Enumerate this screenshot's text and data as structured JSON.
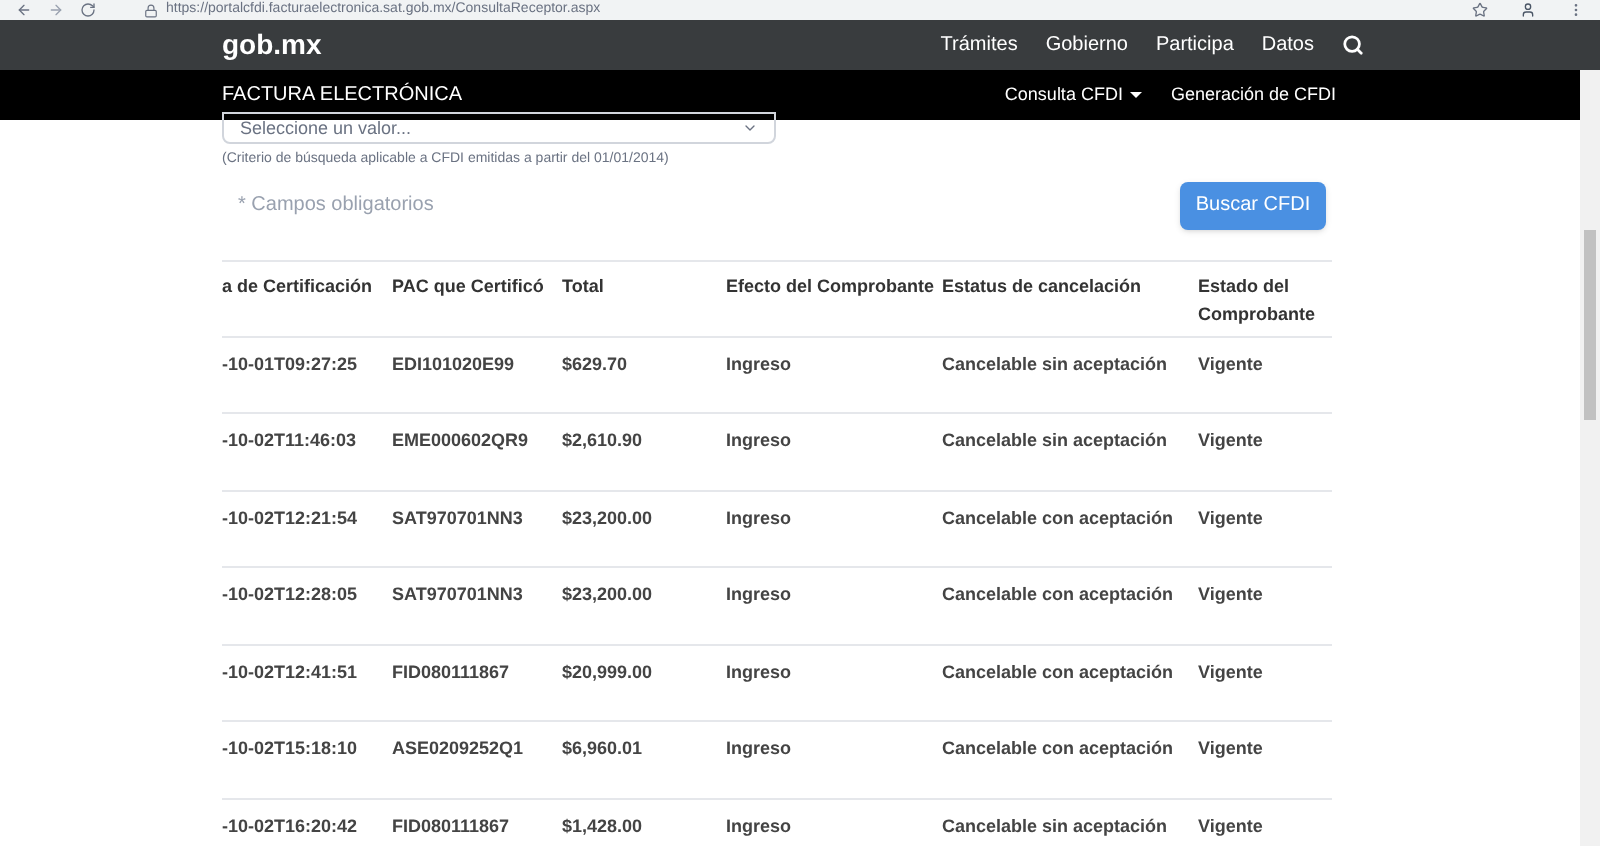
{
  "browser": {
    "url": "https://portalcfdi.facturaelectronica.sat.gob.mx/ConsultaReceptor.aspx"
  },
  "top_nav": {
    "logo": "gob.mx",
    "links": [
      "Trámites",
      "Gobierno",
      "Participa",
      "Datos"
    ]
  },
  "sub_nav": {
    "title": "FACTURA ELECTRÓNICA",
    "links": [
      {
        "label": "Consulta CFDI",
        "kind": "dropdown"
      },
      {
        "label": "Generación de CFDI",
        "kind": "link"
      }
    ]
  },
  "form": {
    "select_placeholder": "Seleccione un valor...",
    "hint": "(Criterio de búsqueda aplicable a CFDI emitidas a partir del 01/01/2014)",
    "required_note": "* Campos obligatorios",
    "search_button": "Buscar CFDI"
  },
  "table": {
    "columns": [
      "a de Certificación",
      "PAC que Certificó",
      "Total",
      "Efecto del Comprobante",
      "Estatus de cancelación",
      "Estado del Comprobante"
    ],
    "rows": [
      [
        "-10-01T09:27:25",
        "EDI101020E99",
        "$629.70",
        "Ingreso",
        "Cancelable sin aceptación",
        "Vigente"
      ],
      [
        "-10-02T11:46:03",
        "EME000602QR9",
        "$2,610.90",
        "Ingreso",
        "Cancelable sin aceptación",
        "Vigente"
      ],
      [
        "-10-02T12:21:54",
        "SAT970701NN3",
        "$23,200.00",
        "Ingreso",
        "Cancelable con aceptación",
        "Vigente"
      ],
      [
        "-10-02T12:28:05",
        "SAT970701NN3",
        "$23,200.00",
        "Ingreso",
        "Cancelable con aceptación",
        "Vigente"
      ],
      [
        "-10-02T12:41:51",
        "FID080111867",
        "$20,999.00",
        "Ingreso",
        "Cancelable con aceptación",
        "Vigente"
      ],
      [
        "-10-02T15:18:10",
        "ASE0209252Q1",
        "$6,960.01",
        "Ingreso",
        "Cancelable con aceptación",
        "Vigente"
      ],
      [
        "-10-02T16:20:42",
        "FID080111867",
        "$1,428.00",
        "Ingreso",
        "Cancelable sin aceptación",
        "Vigente"
      ]
    ]
  }
}
